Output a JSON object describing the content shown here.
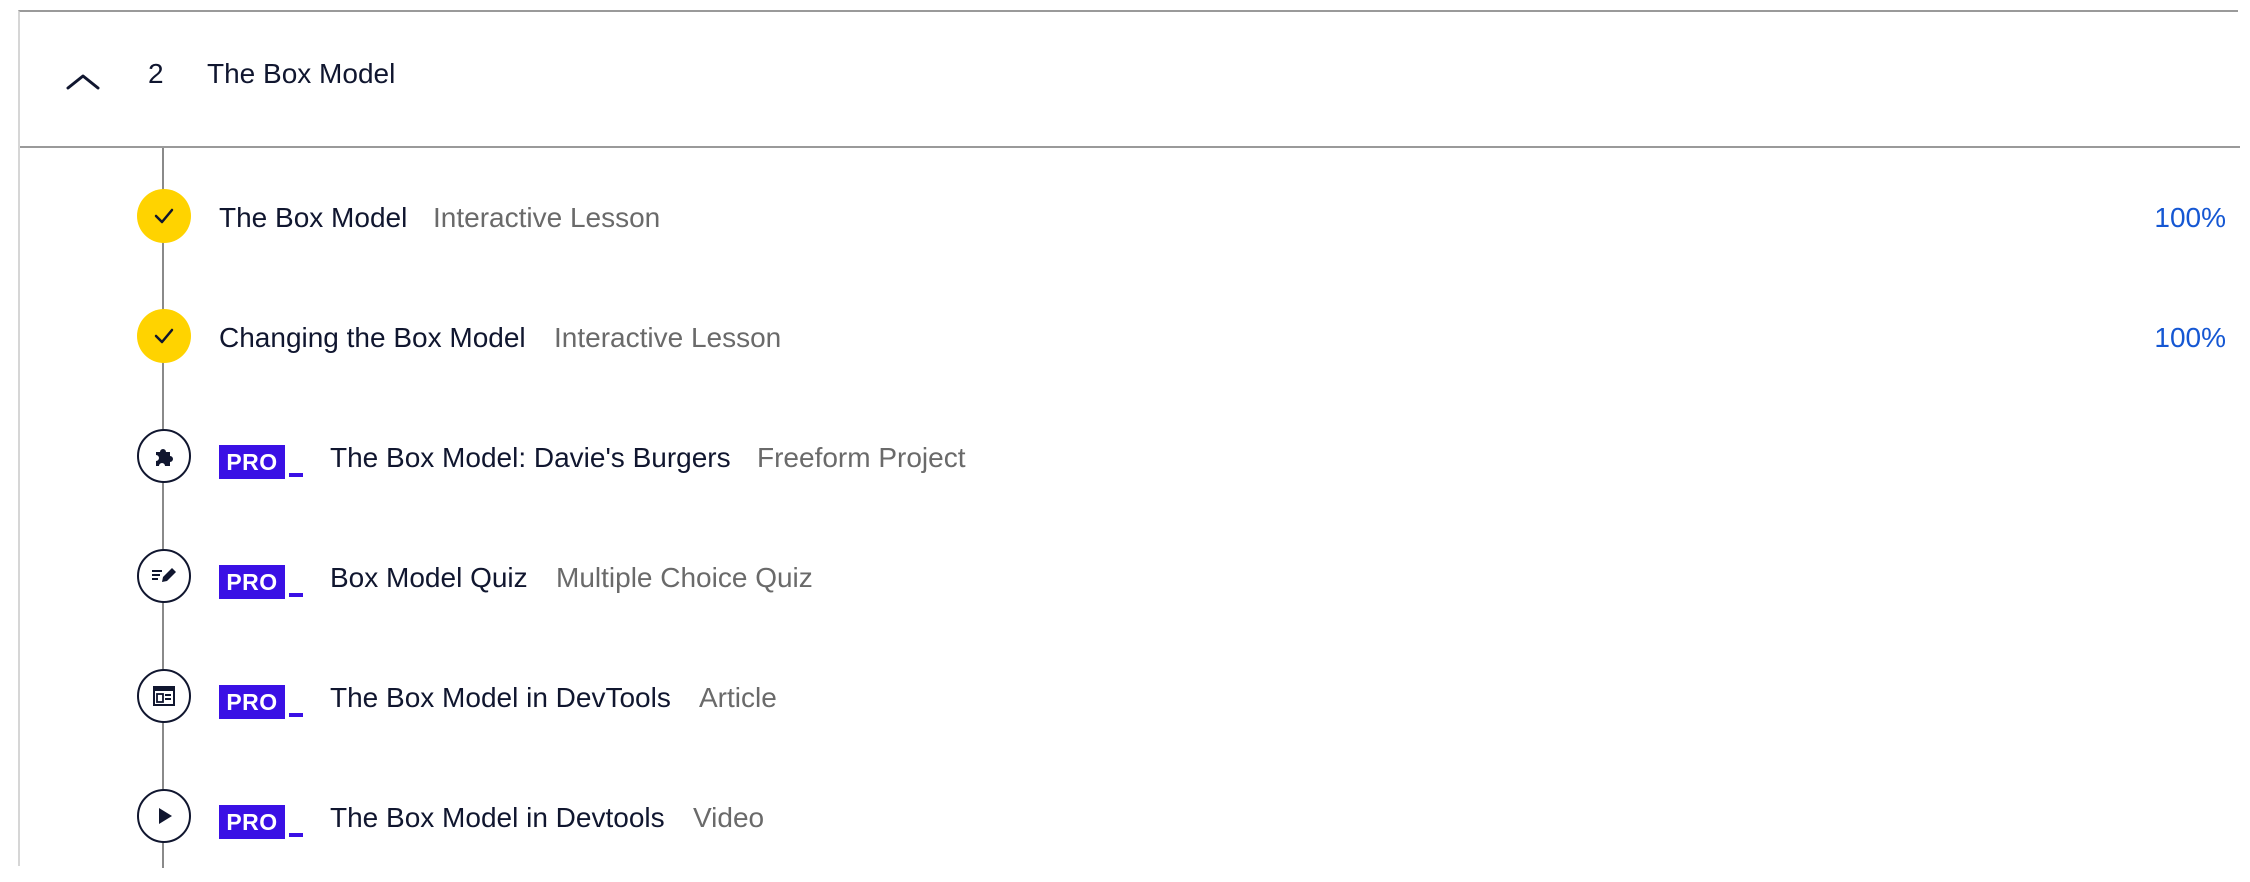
{
  "module": {
    "number": "2",
    "title": "The Box Model",
    "expanded": true,
    "chevron_icon": "chevron-up-icon"
  },
  "items": [
    {
      "title": "The Box Model",
      "type": "Interactive Lesson",
      "progress": "100%",
      "status": "completed",
      "icon": "checkmark-icon",
      "pro": false
    },
    {
      "title": "Changing the Box Model",
      "type": "Interactive Lesson",
      "progress": "100%",
      "status": "completed",
      "icon": "checkmark-icon",
      "pro": false
    },
    {
      "title": "The Box Model: Davie's Burgers",
      "type": "Freeform Project",
      "status": "locked",
      "icon": "puzzle-icon",
      "pro": true,
      "pro_label": "PRO"
    },
    {
      "title": "Box Model Quiz",
      "type": "Multiple Choice Quiz",
      "status": "locked",
      "icon": "quiz-pencil-icon",
      "pro": true,
      "pro_label": "PRO"
    },
    {
      "title": "The Box Model in DevTools",
      "type": "Article",
      "status": "locked",
      "icon": "article-icon",
      "pro": true,
      "pro_label": "PRO"
    },
    {
      "title": "The Box Model in Devtools",
      "type": "Video",
      "status": "locked",
      "icon": "play-icon",
      "pro": true,
      "pro_label": "PRO"
    }
  ],
  "colors": {
    "completed_node": "#ffd300",
    "pro_badge": "#3a10e5",
    "progress_text": "#1557d3",
    "type_text": "#6a6a6a"
  }
}
